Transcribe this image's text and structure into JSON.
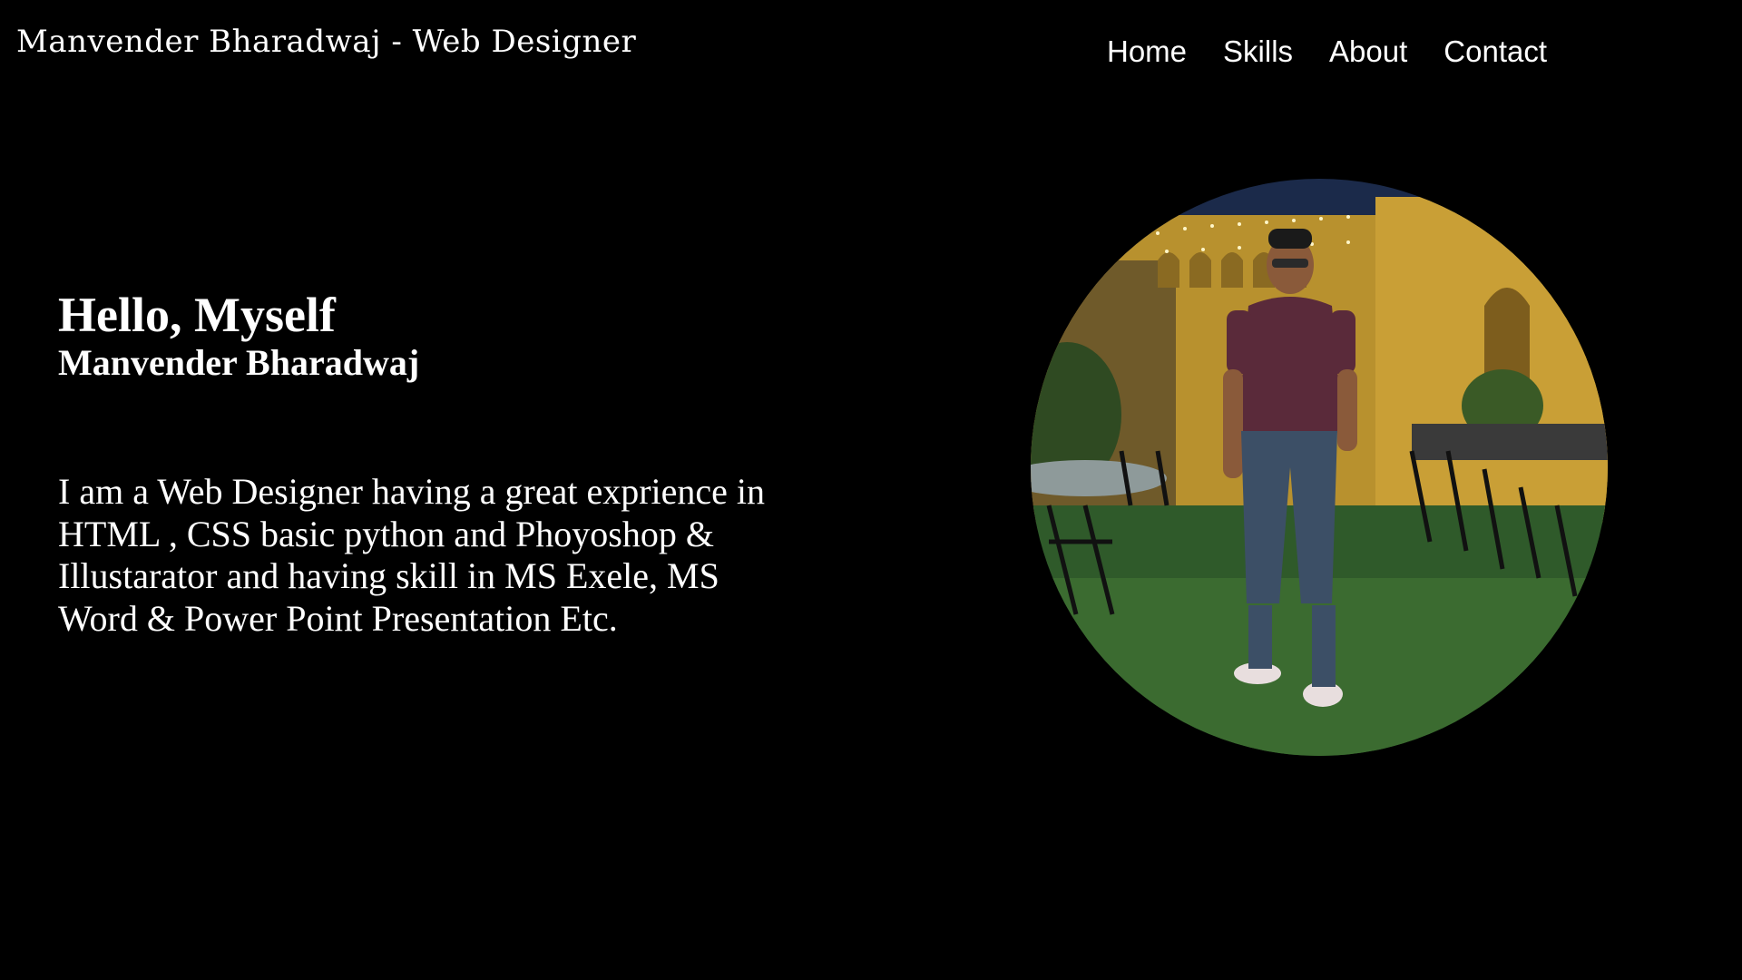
{
  "header": {
    "site_title": "Manvender Bharadwaj - Web Designer",
    "nav": [
      {
        "label": "Home"
      },
      {
        "label": "Skills"
      },
      {
        "label": "About"
      },
      {
        "label": "Contact"
      }
    ]
  },
  "hero": {
    "greeting": "Hello, Myself",
    "name": "Manvender Bharadwaj",
    "bio": "I am a Web Designer having a great exprience in HTML , CSS basic python and Phoyoshop & Illustarator and having skill in MS Exele, MS Word & Power Point Presentation Etc."
  },
  "colors": {
    "background": "#000000",
    "text": "#ffffff"
  }
}
